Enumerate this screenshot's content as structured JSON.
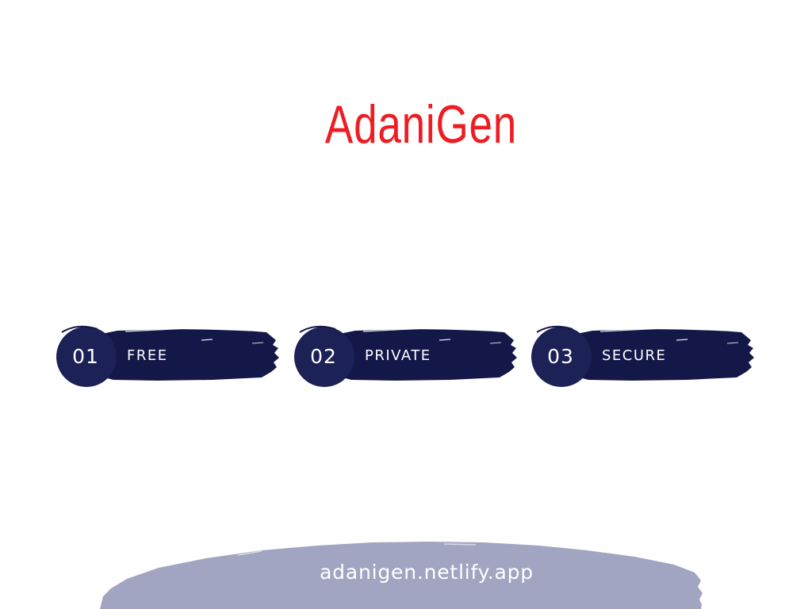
{
  "header": {
    "title": "AdaniGen"
  },
  "features": [
    {
      "number": "01",
      "label": "FREE"
    },
    {
      "number": "02",
      "label": "PRIVATE"
    },
    {
      "number": "03",
      "label": "SECURE"
    }
  ],
  "footer": {
    "url": "adanigen.netlify.app"
  },
  "colors": {
    "title": "#ee1d23",
    "badge": "#141849",
    "footer_blob": "#a2a5c1",
    "text_on_dark": "#ffffff"
  }
}
